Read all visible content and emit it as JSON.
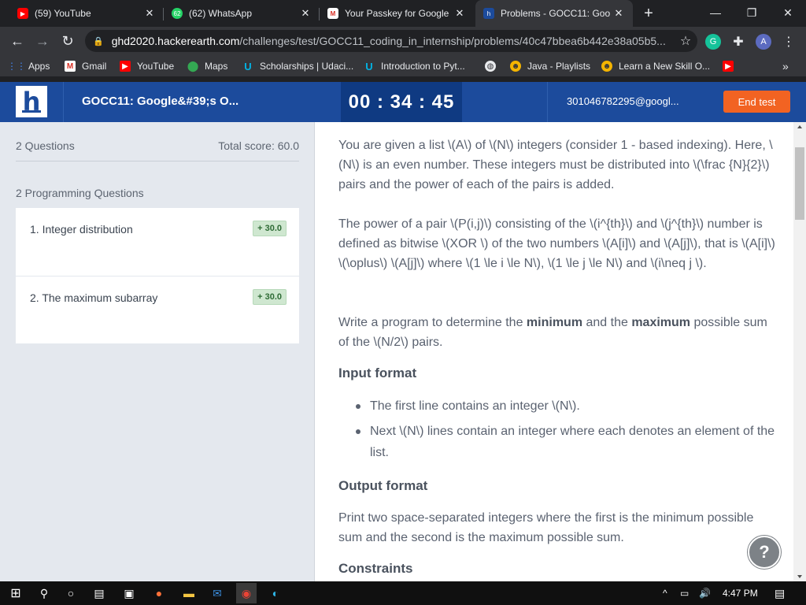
{
  "browser": {
    "tabs": [
      {
        "label": "(59) YouTube",
        "icon": "youtube-icon"
      },
      {
        "label": "(62) WhatsApp",
        "icon": "whatsapp-icon"
      },
      {
        "label": "Your Passkey for Google",
        "icon": "gmail-icon"
      },
      {
        "label": "Problems - GOCC11: Goo",
        "icon": "hackerearth-icon"
      }
    ],
    "new_tab": "+",
    "url_host": "ghd2020.hackerearth.com",
    "url_path": "/challenges/test/GOCC11_coding_in_internship/problems/40c47bbea6b442e38a05b5...",
    "profile_initial": "A",
    "extension_g": "G"
  },
  "bookmarks": [
    {
      "label": "Apps"
    },
    {
      "label": "Gmail"
    },
    {
      "label": "YouTube"
    },
    {
      "label": "Maps"
    },
    {
      "label": "Scholarships | Udaci..."
    },
    {
      "label": "Introduction to Pyt..."
    },
    {
      "label": ""
    },
    {
      "label": "Java - Playlists"
    },
    {
      "label": "Learn a New Skill O..."
    }
  ],
  "header": {
    "logo": "h",
    "contest_title": "GOCC11: Google&#39;s O...",
    "timer": "00 : 34 : 45",
    "email": "301046782295@googl...",
    "end_test": "End test"
  },
  "sidebar": {
    "questions_count": "2 Questions",
    "total_score": "Total score: 60.0",
    "section": "2 Programming Questions",
    "questions": [
      {
        "title": "1. Integer distribution",
        "score": "+ 30.0"
      },
      {
        "title": "2. The maximum subarray",
        "score": "+ 30.0"
      }
    ]
  },
  "problem": {
    "p1": "You are given a list \\(A\\) of \\(N\\) integers (consider 1 - based indexing). Here, \\(N\\) is an even number. These integers must be distributed into \\(\\frac {N}{2}\\) pairs and the power of each of the pairs is added.",
    "p2": "The power of a pair \\(P(i,j)\\) consisting of the \\(i^{th}\\) and \\(j^{th}\\) number is defined as bitwise \\(XOR \\) of the two numbers \\(A[i]\\) and \\(A[j]\\), that is \\(A[i]\\) \\(\\oplus\\) \\(A[j]\\) where \\(1 \\le i \\le N\\),  \\(1 \\le j \\le N\\) and \\(i\\neq j \\).",
    "p3_pre": "Write a program to determine the ",
    "p3_min": "minimum",
    "p3_mid": " and the ",
    "p3_max": "maximum",
    "p3_post": " possible sum of the \\(N/2\\) pairs.",
    "input_heading": "Input format",
    "input_items": [
      "The first line contains an integer \\(N\\).",
      "Next \\(N\\) lines contain an integer where each denotes an element of the list."
    ],
    "output_heading": "Output format",
    "output_text": "Print two space-separated integers where the first is the minimum possible sum and the second is the maximum possible sum.",
    "constraints_heading": "Constraints",
    "help": "?"
  },
  "taskbar": {
    "time": "4:47 PM"
  }
}
